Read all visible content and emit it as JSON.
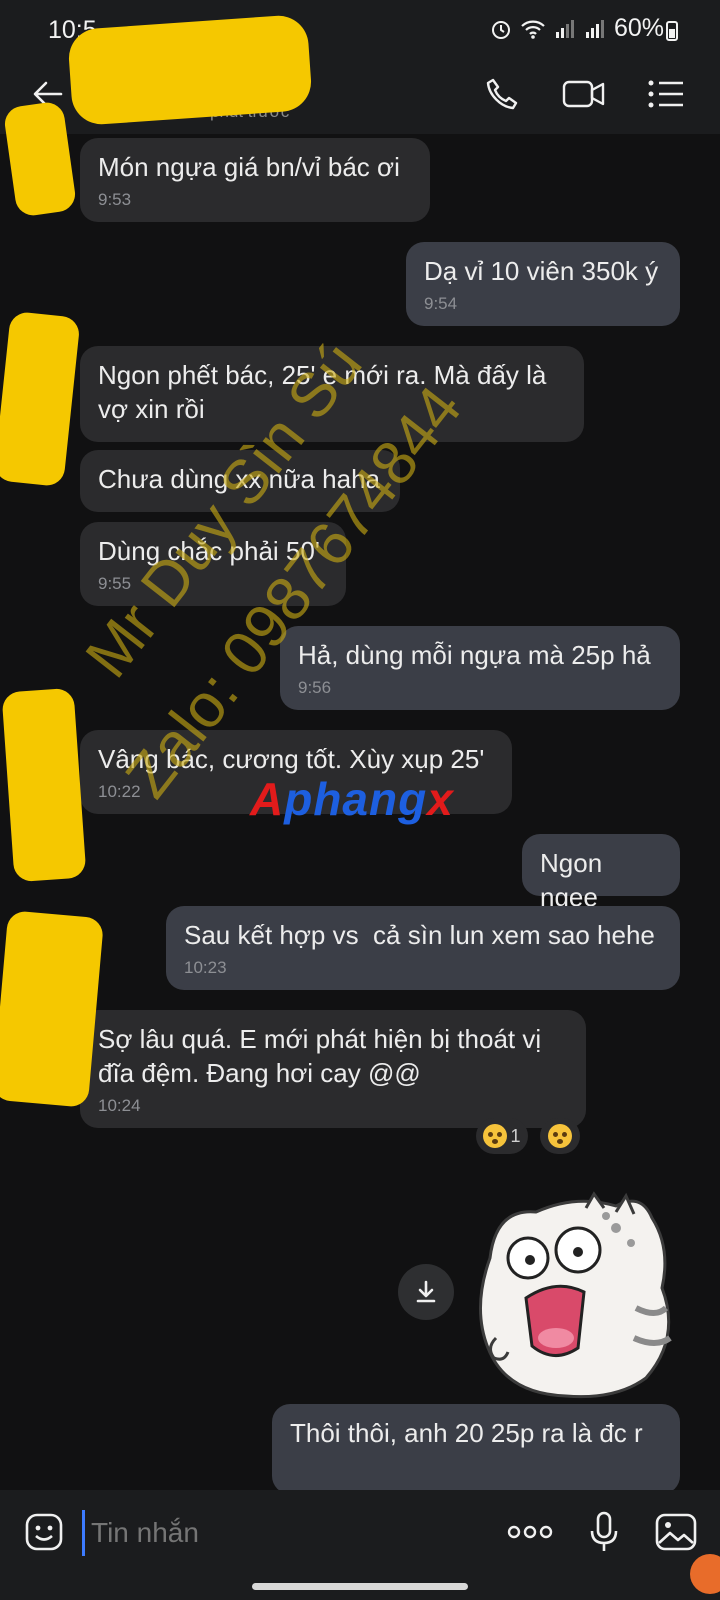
{
  "status_bar": {
    "time": "10:5_",
    "battery": "60%"
  },
  "header": {
    "contact_name": "",
    "contact_subtitle": "phút trước"
  },
  "messages": [
    {
      "dir": "in",
      "text": "Món ngựa giá bn/vỉ bác ơi",
      "time": "9:53"
    },
    {
      "dir": "out",
      "text": "Dạ vỉ 10 viên 350k ý",
      "time": "9:54"
    },
    {
      "dir": "in",
      "text": "Ngon phết bác, 25' e mới ra. Mà đấy là vợ xin rồi",
      "time": ""
    },
    {
      "dir": "in",
      "text": "Chưa dùng xx nữa haha",
      "time": ""
    },
    {
      "dir": "in",
      "text": "Dùng chắc phải 50'",
      "time": "9:55"
    },
    {
      "dir": "out",
      "text": "Hả, dùng mỗi ngựa mà 25p hả",
      "time": "9:56"
    },
    {
      "dir": "in",
      "text": "Vâng bác, cương tốt. Xùy xụp 25'",
      "time": "10:22"
    },
    {
      "dir": "out",
      "text": "Ngon ngee",
      "time": ""
    },
    {
      "dir": "out",
      "text": "Sau kết hợp vs  cả sìn lun xem sao hehe",
      "time": "10:23"
    },
    {
      "dir": "in",
      "text": "Sợ lâu quá. E mới phát hiện bị thoát vị đĩa đệm. Đang hơi cay @@",
      "time": "10:24"
    },
    {
      "dir": "out",
      "text": "Thôi thôi, anh 20 25p ra là đc r",
      "time": ""
    }
  ],
  "reaction": {
    "count": "1",
    "icon": "surprised-emoji"
  },
  "watermark": {
    "line1": "Mr Duy Sìn Sú",
    "line2": "Zalo: 0987674844",
    "brand": [
      "A",
      "phang",
      "x"
    ]
  },
  "composer": {
    "placeholder": "Tin nhắn"
  }
}
